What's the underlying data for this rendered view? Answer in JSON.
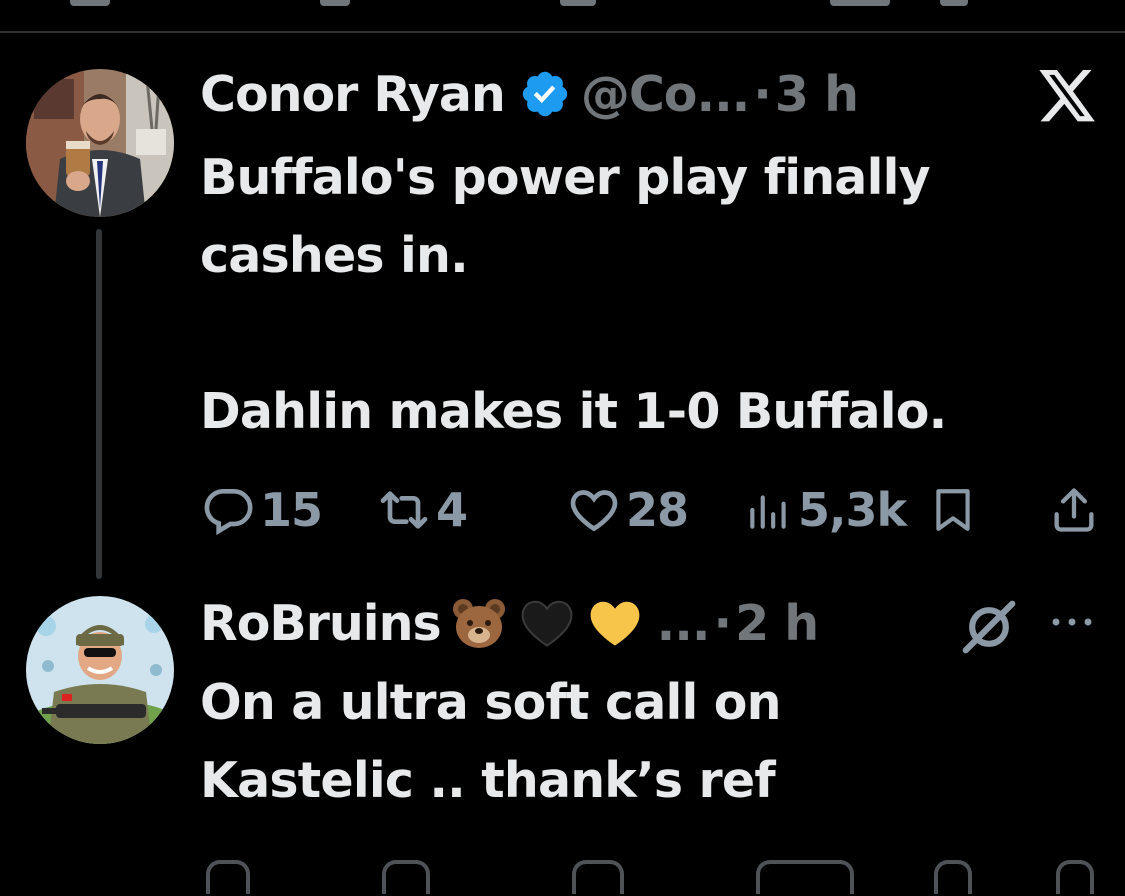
{
  "thread": {
    "tweet": {
      "author_name": "Conor Ryan",
      "handle": "@Co...",
      "separator": "·",
      "time": "3 h",
      "verified": true,
      "text": "Buffalo's power play finally\ncashes in.\n\nDahlin makes it 1-0 Buffalo.",
      "actions": {
        "replies": "15",
        "reposts": "4",
        "likes": "28",
        "views": "5,3k"
      }
    },
    "reply": {
      "author_name": "RoBruins",
      "name_emojis": [
        "bear-emoji",
        "black-heart-emoji",
        "yellow-heart-emoji"
      ],
      "truncation": "...",
      "separator": "·",
      "time": "2 h",
      "text": "On a ultra soft call on\nKastelic .. thank’s ref"
    }
  },
  "icons": {
    "close": "x-logo-icon",
    "grok": "grok-icon",
    "more": "more-options-icon",
    "reply": "reply-icon",
    "repost": "repost-icon",
    "like": "like-icon",
    "views": "views-icon",
    "bookmark": "bookmark-icon",
    "share": "share-icon"
  },
  "colors": {
    "background": "#000000",
    "text": "#e7e9ea",
    "secondary": "#71767b",
    "verified": "#1d9bf0"
  }
}
